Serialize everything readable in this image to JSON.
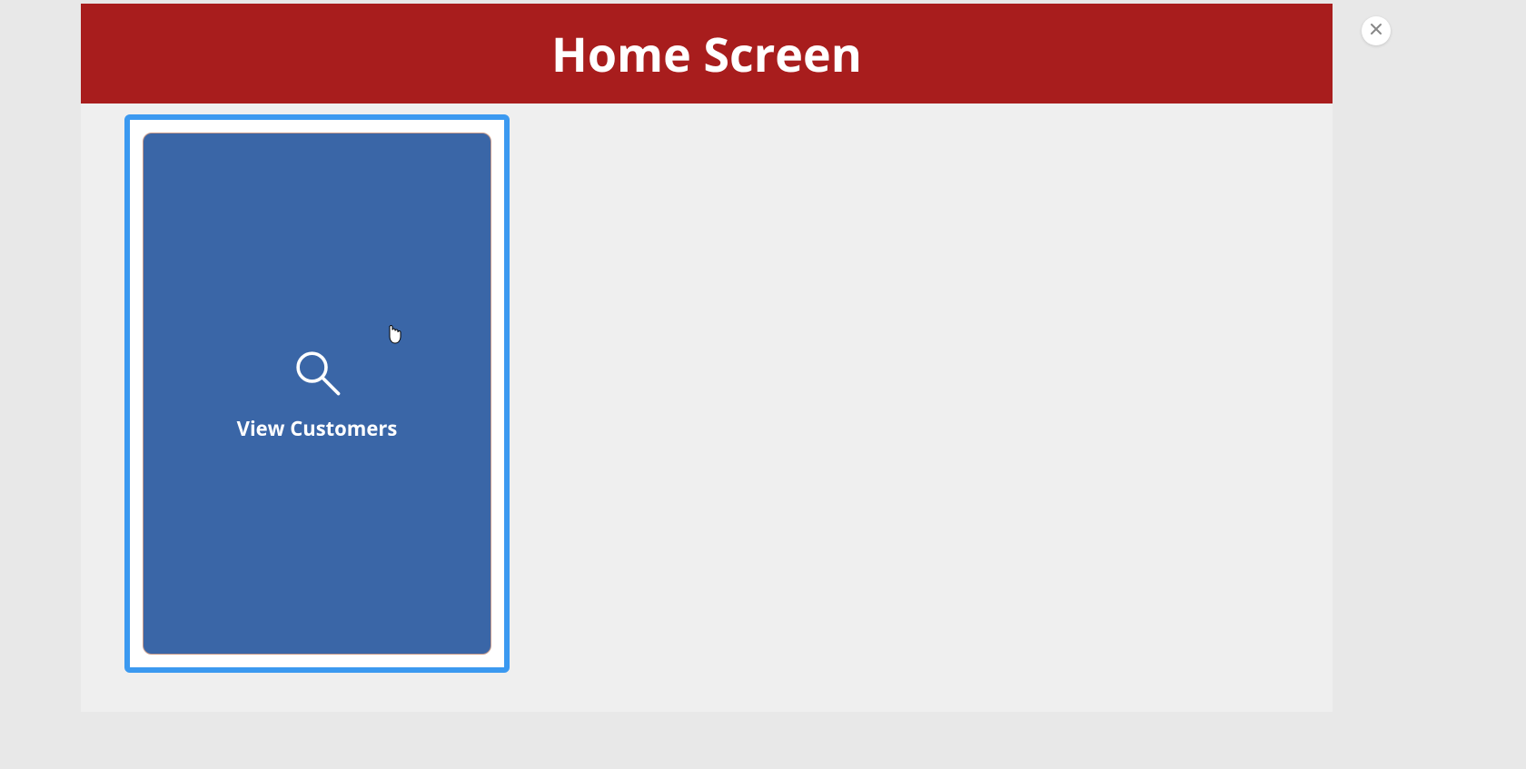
{
  "header": {
    "title": "Home Screen"
  },
  "cards": [
    {
      "icon": "search-icon",
      "label": "View Customers"
    }
  ],
  "colors": {
    "header_bg": "#a81d1d",
    "card_bg": "#3a66a7",
    "selection_border": "#3b99f0"
  }
}
